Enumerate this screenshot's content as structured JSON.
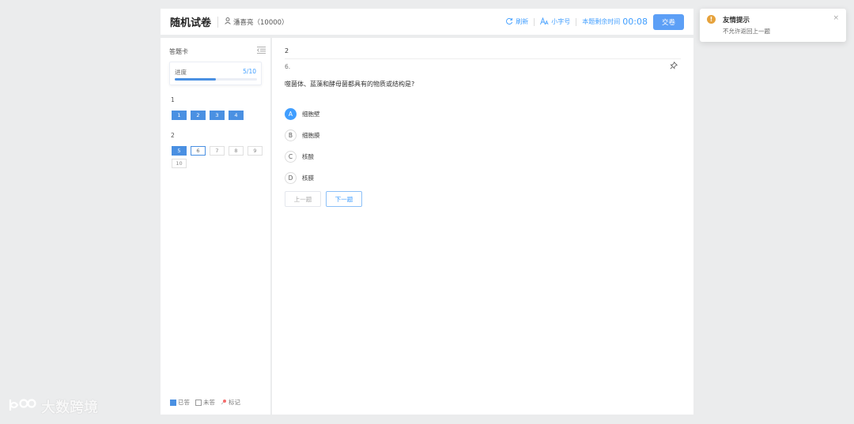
{
  "header": {
    "title": "随机试卷",
    "user": "潘喜亮（10000）",
    "refresh_label": "刷新",
    "font_label": "小字号",
    "timer_label": "本题剩余时间",
    "timer_value": "00:08",
    "submit_label": "交卷"
  },
  "sidebar": {
    "title": "答题卡",
    "progress_label": "进度",
    "progress_count": "5/10",
    "progress_fraction": 0.5,
    "groups": [
      {
        "label": "1",
        "questions": [
          {
            "no": "1",
            "state": "answered"
          },
          {
            "no": "2",
            "state": "answered"
          },
          {
            "no": "3",
            "state": "answered"
          },
          {
            "no": "4",
            "state": "answered"
          }
        ]
      },
      {
        "label": "2",
        "questions": [
          {
            "no": "5",
            "state": "answered"
          },
          {
            "no": "6",
            "state": "current"
          },
          {
            "no": "7",
            "state": "unanswered"
          },
          {
            "no": "8",
            "state": "unanswered"
          },
          {
            "no": "9",
            "state": "unanswered"
          },
          {
            "no": "10",
            "state": "unanswered"
          }
        ]
      }
    ],
    "legend": {
      "answered": "已答",
      "unanswered": "未答",
      "marked": "标记"
    }
  },
  "main": {
    "group_no": "2",
    "question_no": "6.",
    "question_text": "噬菌体、蓝藻和酵母菌都具有的物质或结构是?",
    "options": [
      {
        "letter": "A",
        "text": "细胞壁",
        "selected": true
      },
      {
        "letter": "B",
        "text": "细胞膜",
        "selected": false
      },
      {
        "letter": "C",
        "text": "核酸",
        "selected": false
      },
      {
        "letter": "D",
        "text": "核膜",
        "selected": false
      }
    ],
    "prev_label": "上一题",
    "next_label": "下一题"
  },
  "toast": {
    "title": "友情提示",
    "message": "不允许返回上一题",
    "close": "×"
  },
  "watermark": {
    "text": "大数跨境"
  },
  "colors": {
    "accent": "#409eff",
    "answered": "#4a90e2",
    "warning": "#e6a23c",
    "background": "#ebeced"
  }
}
